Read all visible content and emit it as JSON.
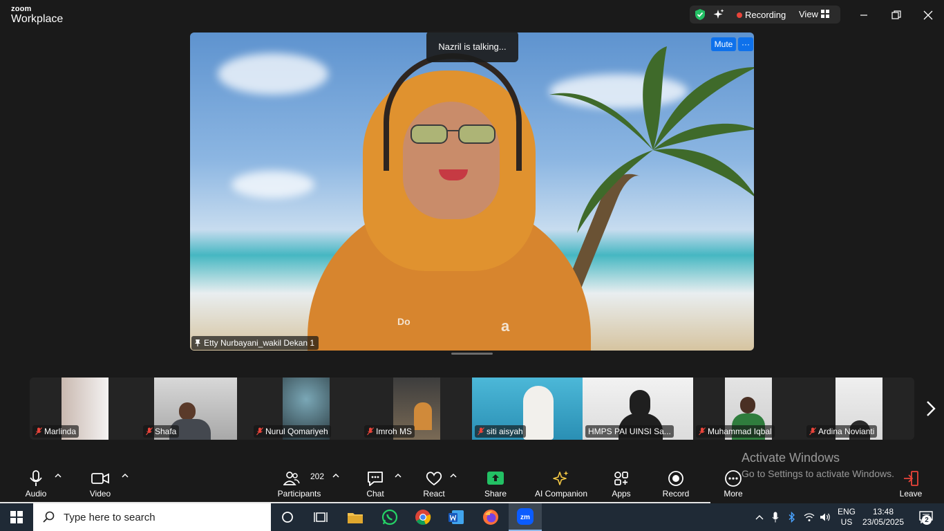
{
  "app": {
    "logo_small": "zoom",
    "logo_big": "Workplace",
    "status": {
      "recording_label": "Recording",
      "view_label": "View",
      "recording_color": "#e8443a",
      "shield_color": "#23c064"
    }
  },
  "main_video": {
    "talking_label": "Nazril is talking...",
    "mute_label": "Mute",
    "more_label": "···",
    "participant_name": "Etty Nurbayani_wakil Dekan 1",
    "shirt_text_left": "Do",
    "shirt_text_right": "a"
  },
  "filmstrip": {
    "tiles": [
      {
        "name": "Marlinda",
        "muted": true
      },
      {
        "name": "Shafa",
        "muted": true
      },
      {
        "name": "Nurul Qomariyeh",
        "muted": true
      },
      {
        "name": "Imroh MS",
        "muted": true
      },
      {
        "name": "siti aisyah",
        "muted": true
      },
      {
        "name": "HMPS PAI UINSI Sa...",
        "muted": false
      },
      {
        "name": "Muhammad Iqbal",
        "muted": true
      },
      {
        "name": "Ardina Novianti",
        "muted": true
      }
    ]
  },
  "toolbar": {
    "audio": "Audio",
    "video": "Video",
    "participants": "Participants",
    "participants_count": "202",
    "chat": "Chat",
    "react": "React",
    "share": "Share",
    "ai_companion": "AI Companion",
    "apps": "Apps",
    "record": "Record",
    "more": "More",
    "leave": "Leave",
    "share_color": "#23c064",
    "ai_color": "#f5c945",
    "leave_color": "#e8443a"
  },
  "watermark": {
    "line1": "Activate Windows",
    "line2": "Go to Settings to activate Windows."
  },
  "taskbar": {
    "search_placeholder": "Type here to search",
    "lang_top": "ENG",
    "lang_bottom": "US",
    "time": "13:48",
    "date": "23/05/2025",
    "notification_count": "2"
  }
}
